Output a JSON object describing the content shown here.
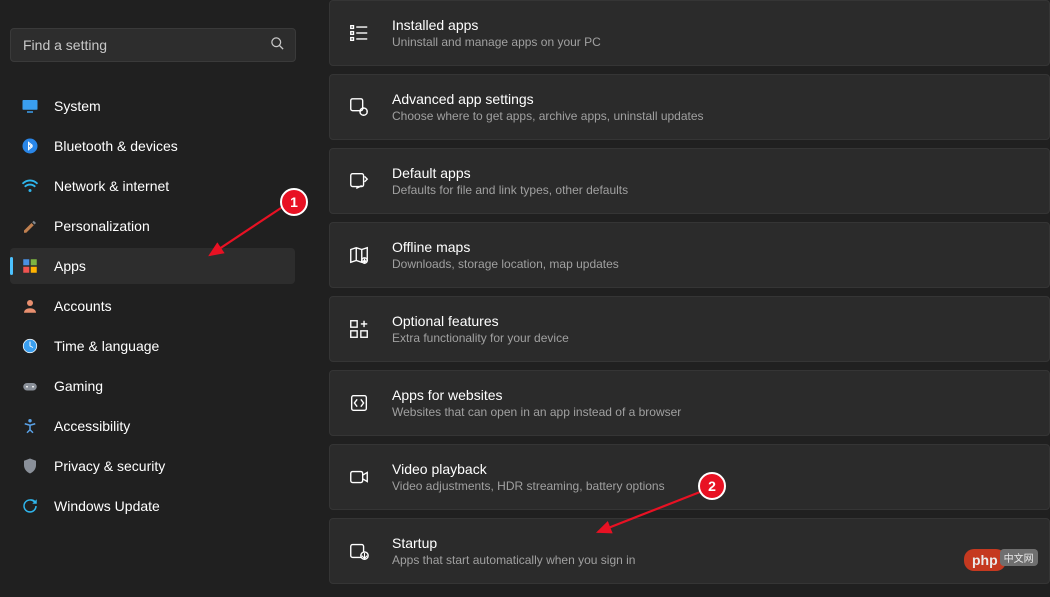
{
  "search": {
    "placeholder": "Find a setting"
  },
  "sidebar": {
    "items": [
      {
        "label": "System"
      },
      {
        "label": "Bluetooth & devices"
      },
      {
        "label": "Network & internet"
      },
      {
        "label": "Personalization"
      },
      {
        "label": "Apps"
      },
      {
        "label": "Accounts"
      },
      {
        "label": "Time & language"
      },
      {
        "label": "Gaming"
      },
      {
        "label": "Accessibility"
      },
      {
        "label": "Privacy & security"
      },
      {
        "label": "Windows Update"
      }
    ]
  },
  "main": {
    "cards": [
      {
        "title": "Installed apps",
        "sub": "Uninstall and manage apps on your PC"
      },
      {
        "title": "Advanced app settings",
        "sub": "Choose where to get apps, archive apps, uninstall updates"
      },
      {
        "title": "Default apps",
        "sub": "Defaults for file and link types, other defaults"
      },
      {
        "title": "Offline maps",
        "sub": "Downloads, storage location, map updates"
      },
      {
        "title": "Optional features",
        "sub": "Extra functionality for your device"
      },
      {
        "title": "Apps for websites",
        "sub": "Websites that can open in an app instead of a browser"
      },
      {
        "title": "Video playback",
        "sub": "Video adjustments, HDR streaming, battery options"
      },
      {
        "title": "Startup",
        "sub": "Apps that start automatically when you sign in"
      }
    ]
  },
  "annotations": {
    "badge1": "1",
    "badge2": "2"
  },
  "watermark": {
    "text": "php",
    "suffix": "中文网"
  }
}
